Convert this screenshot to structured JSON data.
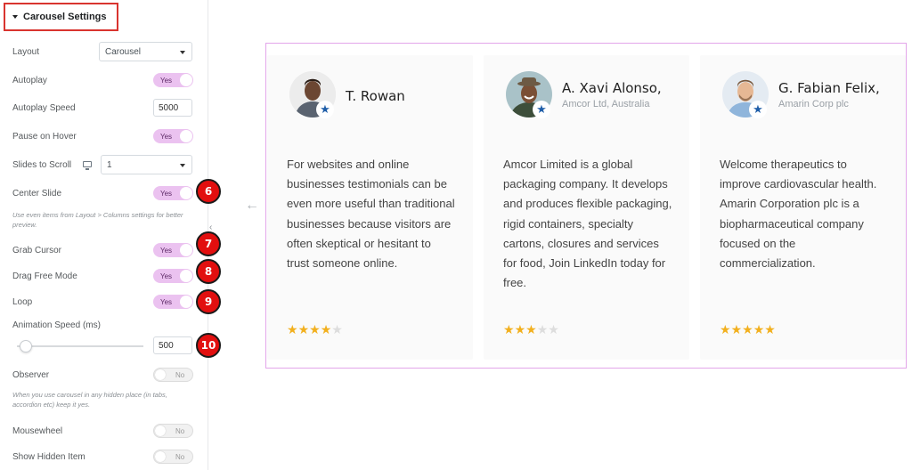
{
  "panel": {
    "section_title": "Carousel Settings",
    "layout_label": "Layout",
    "layout_value": "Carousel",
    "autoplay_label": "Autoplay",
    "autoplay_value": "Yes",
    "autoplay_speed_label": "Autoplay Speed",
    "autoplay_speed_value": "5000",
    "pause_hover_label": "Pause on Hover",
    "pause_hover_value": "Yes",
    "slides_scroll_label": "Slides to Scroll",
    "slides_scroll_value": "1",
    "center_slide_label": "Center Slide",
    "center_slide_value": "Yes",
    "center_note": "Use even items from Layout > Columns settings for better preview.",
    "grab_cursor_label": "Grab Cursor",
    "grab_cursor_value": "Yes",
    "drag_free_label": "Drag Free Mode",
    "drag_free_value": "Yes",
    "loop_label": "Loop",
    "loop_value": "Yes",
    "anim_speed_label": "Animation Speed (ms)",
    "anim_speed_value": "500",
    "anim_speed_slider_fraction": 0.03,
    "observer_label": "Observer",
    "observer_value": "No",
    "observer_note": "When you use carousel in any hidden place (in tabs, accordion etc) keep it yes.",
    "mousewheel_label": "Mousewheel",
    "mousewheel_value": "No",
    "show_hidden_label": "Show Hidden Item",
    "show_hidden_value": "No"
  },
  "badges": [
    "6",
    "7",
    "8",
    "9",
    "10"
  ],
  "colors": {
    "accent_toggle": "#ebc2f0",
    "badge_red": "#e20f0f",
    "preview_border": "#e3a6ea",
    "star_gold": "#f2b01e",
    "verified_blue": "#1f5ea8"
  },
  "testimonials": [
    {
      "name": "T. Rowan",
      "company": "",
      "text": "For websites and online businesses testimonials can be even more useful than traditional businesses because visitors are often skeptical or hesitant to trust someone online.",
      "rating": 4
    },
    {
      "name": "A. Xavi Alonso,",
      "company": "Amcor Ltd, Australia",
      "text": "Amcor Limited is a global packaging company. It develops and produces flexible packaging, rigid containers, specialty cartons, closures and services for food, Join LinkedIn today for free.",
      "rating": 3
    },
    {
      "name": "G. Fabian Felix,",
      "company": "Amarin Corp plc",
      "text": "Welcome therapeutics to improve cardiovascular health. Amarin Corporation plc is a biopharmaceutical company focused on the commercialization.",
      "rating": 5
    }
  ]
}
